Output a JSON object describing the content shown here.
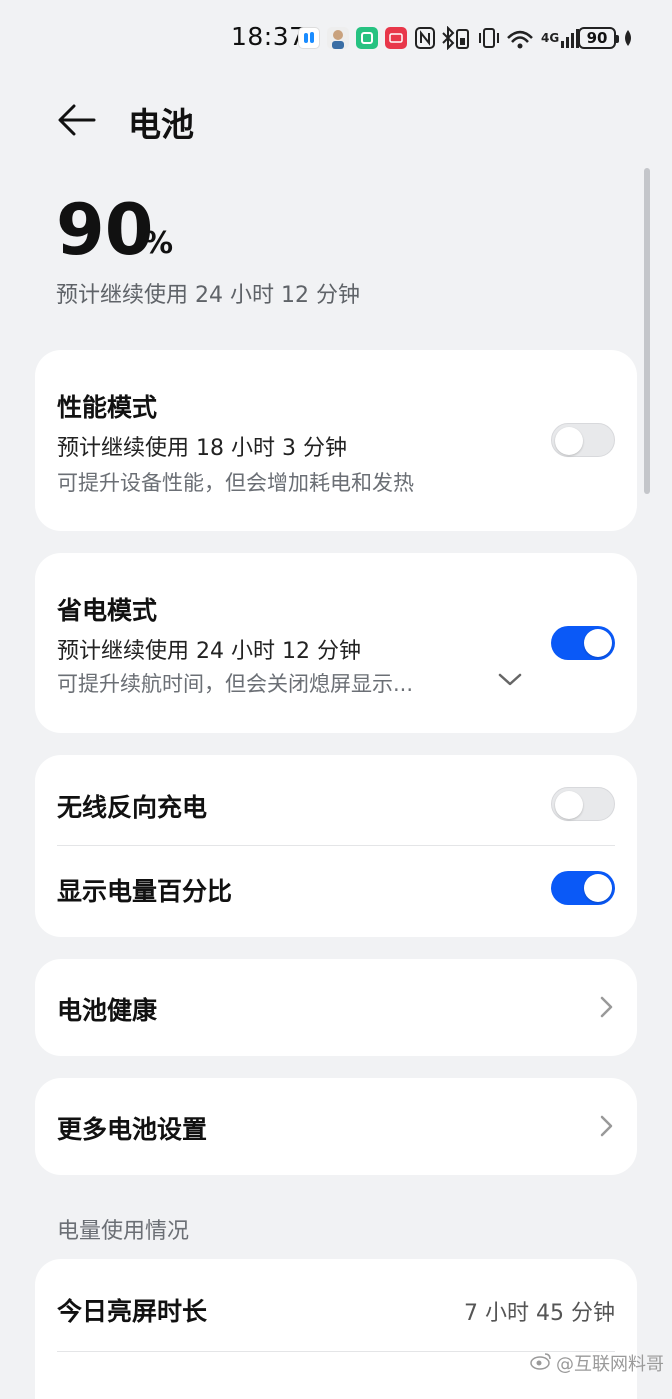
{
  "status_bar": {
    "time": "18:37",
    "battery": "90",
    "network": "4G",
    "icons": [
      "notification-app-icon",
      "contact-avatar-icon",
      "mi-home-icon",
      "huawei-app-icon",
      "nfc-icon",
      "bluetooth-icon",
      "vibrate-icon",
      "wifi-icon",
      "signal-icon",
      "battery-icon",
      "leaf-icon"
    ]
  },
  "header": {
    "title": "电池"
  },
  "battery": {
    "percent": "90",
    "percent_sign": "%",
    "estimate": "预计继续使用 24 小时 12 分钟"
  },
  "performance_mode": {
    "title": "性能模式",
    "estimate": "预计继续使用 18 小时 3 分钟",
    "description": "可提升设备性能，但会增加耗电和发热",
    "enabled": false
  },
  "power_saving_mode": {
    "title": "省电模式",
    "estimate": "预计继续使用 24 小时 12 分钟",
    "description": "可提升续航时间，但会关闭熄屏显示...",
    "enabled": true
  },
  "toggles": [
    {
      "label": "无线反向充电",
      "enabled": false
    },
    {
      "label": "显示电量百分比",
      "enabled": true
    }
  ],
  "battery_health": {
    "label": "电池健康"
  },
  "more_settings": {
    "label": "更多电池设置"
  },
  "usage_section": {
    "heading": "电量使用情况",
    "screen_on_label": "今日亮屏时长",
    "screen_on_value": "7 小时 45 分钟"
  },
  "watermark": "@互联网料哥",
  "colors": {
    "accent": "#0a59f7",
    "background": "#f1f2f4",
    "card": "#ffffff"
  }
}
